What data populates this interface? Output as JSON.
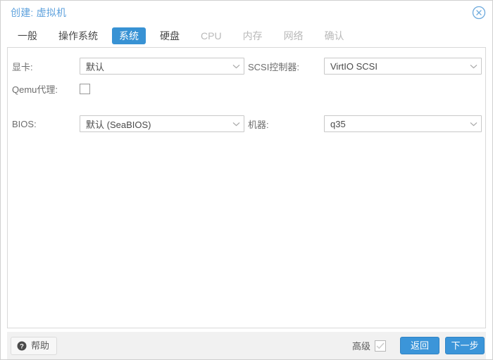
{
  "dialog": {
    "title": "创建: 虚拟机",
    "close_icon": "close-circle-icon"
  },
  "tabs": [
    {
      "label": "一般",
      "state": "enabled"
    },
    {
      "label": "操作系统",
      "state": "enabled"
    },
    {
      "label": "系统",
      "state": "active"
    },
    {
      "label": "硬盘",
      "state": "enabled"
    },
    {
      "label": "CPU",
      "state": "disabled"
    },
    {
      "label": "内存",
      "state": "disabled"
    },
    {
      "label": "网络",
      "state": "disabled"
    },
    {
      "label": "确认",
      "state": "disabled"
    }
  ],
  "form": {
    "left": {
      "graphic_card": {
        "label": "显卡:",
        "value": "默认"
      },
      "qemu_agent": {
        "label": "Qemu代理:",
        "checked": false
      },
      "bios": {
        "label": "BIOS:",
        "value": "默认 (SeaBIOS)"
      }
    },
    "right": {
      "scsi_controller": {
        "label": "SCSI控制器:",
        "value": "VirtIO SCSI"
      },
      "machine": {
        "label": "机器:",
        "value": "q35"
      }
    }
  },
  "footer": {
    "help_label": "帮助",
    "advanced_label": "高级",
    "advanced_checked": true,
    "back_label": "返回",
    "next_label": "下一步"
  },
  "colors": {
    "accent": "#3892d4",
    "title_blue": "#5fa2dd",
    "button_blue": "#3b95d9",
    "panel_border": "#d9d9d9",
    "footer_bg": "#f1f1f1",
    "disabled_text": "#b9b9b9"
  }
}
